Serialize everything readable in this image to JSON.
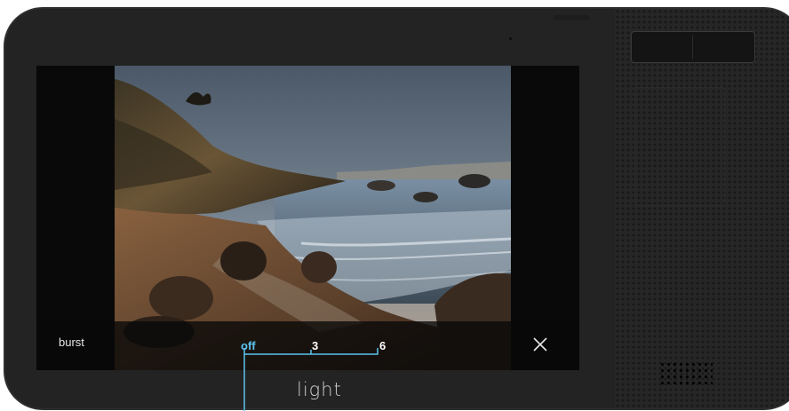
{
  "device": {
    "brand": "light"
  },
  "burst_menu": {
    "title": "burst",
    "options": [
      "off",
      "3",
      "6"
    ],
    "selected": "off",
    "accent_color": "#5cc3ee",
    "close_icon": "close-icon"
  },
  "photo": {
    "subject": "coastal-beach-sunset"
  }
}
